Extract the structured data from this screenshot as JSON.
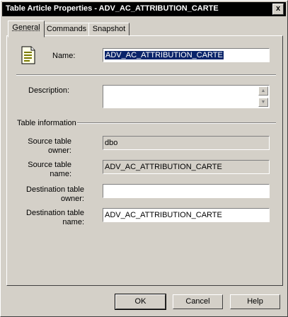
{
  "window": {
    "title": "Table Article Properties - ADV_AC_ATTRIBUTION_CARTE",
    "close_glyph": "x"
  },
  "tabs": [
    {
      "label": "General"
    },
    {
      "label": "Commands"
    },
    {
      "label": "Snapshot"
    }
  ],
  "general": {
    "name_label": "Name:",
    "name_value": "ADV_AC_ATTRIBUTION_CARTE",
    "description_label": "Description:",
    "description_value": "",
    "section_title": "Table information",
    "source_owner_label_1": "Source table",
    "source_owner_label_2": "owner:",
    "source_owner_value": "dbo",
    "source_name_label_1": "Source table",
    "source_name_label_2": "name:",
    "source_name_value": "ADV_AC_ATTRIBUTION_CARTE",
    "dest_owner_label_1": "Destination table",
    "dest_owner_label_2": "owner:",
    "dest_owner_value": "",
    "dest_name_label_1": "Destination table",
    "dest_name_label_2": "name:",
    "dest_name_value": "ADV_AC_ATTRIBUTION_CARTE"
  },
  "buttons": {
    "ok": "OK",
    "cancel": "Cancel",
    "help": "Help"
  },
  "icons": {
    "article": "table-article-icon"
  }
}
